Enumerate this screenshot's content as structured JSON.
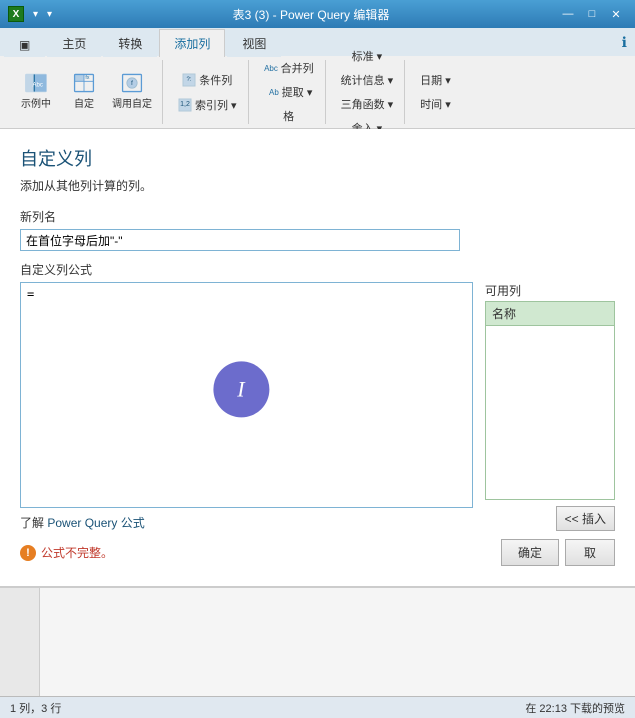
{
  "titlebar": {
    "icon_label": "X",
    "quick_actions": [
      "▾",
      "▾"
    ],
    "title": "表3 (3) - Power Query 编辑器",
    "minimize": "—",
    "maximize": "□",
    "close": "✕"
  },
  "ribbon": {
    "tabs": [
      {
        "id": "file",
        "label": "▣",
        "active": false
      },
      {
        "id": "home",
        "label": "主页",
        "active": false
      },
      {
        "id": "transform",
        "label": "转换",
        "active": false
      },
      {
        "id": "addcol",
        "label": "添加列",
        "active": true
      },
      {
        "id": "view",
        "label": "视图",
        "active": false
      }
    ],
    "help_icon": "ℹ",
    "groups": {
      "general": {
        "buttons": [
          {
            "label": "示例中",
            "icon": "table"
          },
          {
            "label": "自定",
            "icon": "col"
          },
          {
            "label": "调用自定",
            "icon": "func"
          }
        ]
      },
      "from_text": {
        "small_buttons": [
          {
            "label": "条件列"
          },
          {
            "label": "索引列 ▾"
          },
          {
            "label": "合并列"
          },
          {
            "label": "提取 ▾"
          },
          {
            "label": "格"
          },
          {
            "label": "标准 ▾"
          },
          {
            "label": "统计信息 ▾"
          },
          {
            "label": "三角函数 ▾"
          },
          {
            "label": "舍入 ▾"
          },
          {
            "label": "日期 ▾"
          },
          {
            "label": "时间 ▾"
          }
        ]
      }
    }
  },
  "dialog": {
    "title": "自定义列",
    "subtitle": "添加从其他列计算的列。",
    "new_col_label": "新列名",
    "new_col_value": "在首位字母后加\"-\"",
    "formula_label": "自定义列公式",
    "formula_value": "=|",
    "learn_prefix": "了解 ",
    "learn_link": "Power Query 公式",
    "available_label": "可用列",
    "available_header": "名称",
    "insert_btn": "<< 插入",
    "error_icon": "!",
    "error_msg": "公式不完整。",
    "ok_btn": "确定",
    "cancel_btn": "取"
  },
  "statusbar": {
    "left": "1 列，3 行",
    "right": "在 22:13 下载的预览"
  }
}
